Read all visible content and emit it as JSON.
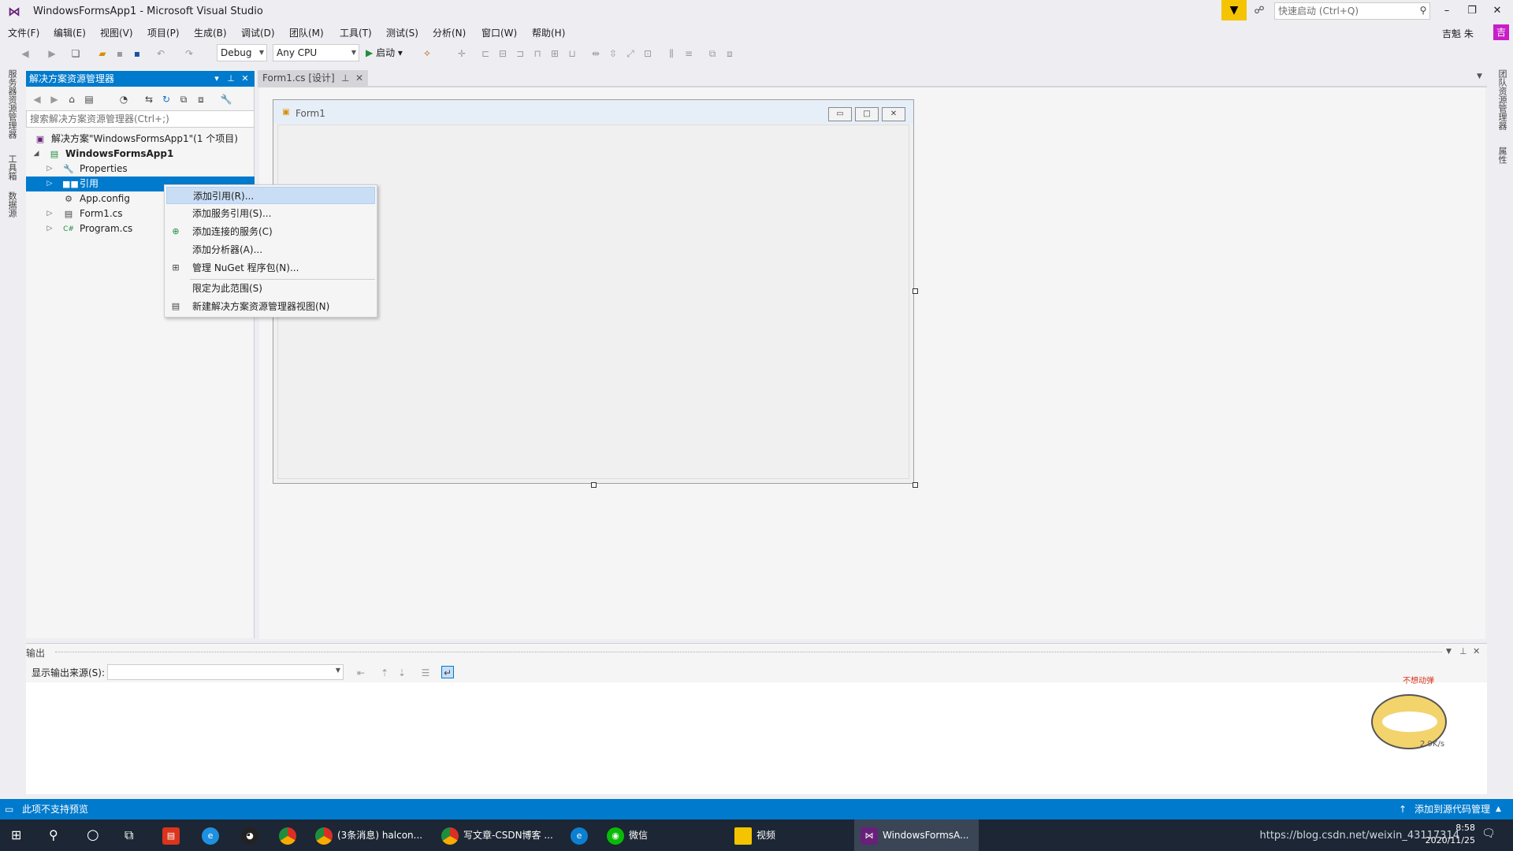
{
  "window": {
    "title": "WindowsFormsApp1 - Microsoft Visual Studio",
    "quick_launch_placeholder": "快速启动 (Ctrl+Q)",
    "user_name": "吉魁 朱",
    "avatar_letter": "吉"
  },
  "menu": [
    "文件(F)",
    "编辑(E)",
    "视图(V)",
    "项目(P)",
    "生成(B)",
    "调试(D)",
    "团队(M)",
    "工具(T)",
    "测试(S)",
    "分析(N)",
    "窗口(W)",
    "帮助(H)"
  ],
  "toolbar": {
    "config": "Debug",
    "platform": "Any CPU",
    "start_label": "启动"
  },
  "left_tabs": [
    "服务器资源管理器",
    "工具箱",
    "数据源"
  ],
  "right_tabs": [
    "团队资源管理器",
    "属性"
  ],
  "solution_explorer": {
    "title": "解决方案资源管理器",
    "search_placeholder": "搜索解决方案资源管理器(Ctrl+;)",
    "tree": [
      {
        "label": "解决方案\"WindowsFormsApp1\"(1 个项目)",
        "icon": "solution-icon"
      },
      {
        "label": "WindowsFormsApp1",
        "icon": "csharp-project-icon"
      },
      {
        "label": "Properties",
        "icon": "wrench-icon"
      },
      {
        "label": "引用",
        "icon": "references-icon"
      },
      {
        "label": "App.config",
        "icon": "config-file-icon"
      },
      {
        "label": "Form1.cs",
        "icon": "form-file-icon"
      },
      {
        "label": "Program.cs",
        "icon": "csharp-file-icon"
      }
    ]
  },
  "context_menu": [
    {
      "label": "添加引用(R)...",
      "icon": ""
    },
    {
      "label": "添加服务引用(S)...",
      "icon": ""
    },
    {
      "label": "添加连接的服务(C)",
      "icon": "connected-service-icon"
    },
    {
      "label": "添加分析器(A)...",
      "icon": ""
    },
    {
      "label": "管理 NuGet 程序包(N)...",
      "icon": "nuget-icon"
    },
    {
      "label": "限定为此范围(S)",
      "icon": ""
    },
    {
      "label": "新建解决方案资源管理器视图(N)",
      "icon": "new-view-icon"
    }
  ],
  "document": {
    "tab_label": "Form1.cs [设计]",
    "form_title": "Form1"
  },
  "output": {
    "title": "输出",
    "source_label": "显示输出来源(S):"
  },
  "mascot": {
    "caption": "不想动弹",
    "speed": "2.9K/s"
  },
  "status": {
    "left": "此项不支持预览",
    "right": "添加到源代码管理"
  },
  "taskbar": {
    "items": [
      {
        "label": "(3条消息) halcon...",
        "icon": "chrome-icon"
      },
      {
        "label": "写文章-CSDN博客 ...",
        "icon": "chrome-icon"
      },
      {
        "label": "微信",
        "icon": "wechat-icon"
      },
      {
        "label": "视频",
        "icon": "folder-icon"
      },
      {
        "label": "WindowsFormsA...",
        "icon": "visual-studio-icon"
      }
    ],
    "tray_watermark": "https://blog.csdn.net/weixin_43117314",
    "time": "8:58",
    "date": "2020/11/25"
  }
}
